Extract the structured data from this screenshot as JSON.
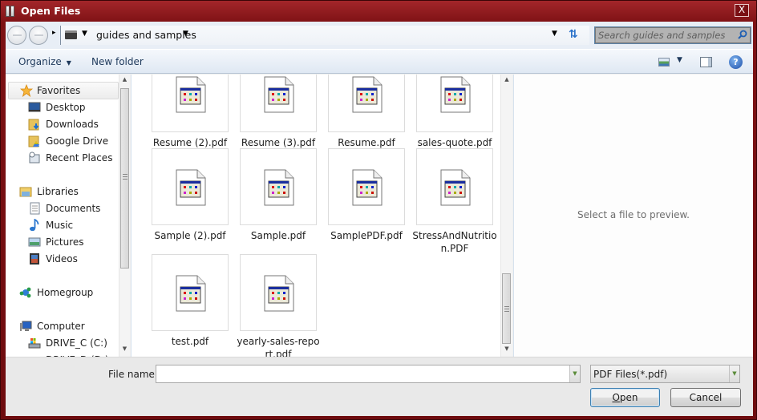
{
  "window": {
    "title": "Open Files",
    "close_label": "X"
  },
  "navbar": {
    "breadcrumb": "guides and samples",
    "search_placeholder": "Search guides and samples"
  },
  "toolbar": {
    "organize_label": "Organize",
    "new_folder_label": "New folder",
    "help_label": "?"
  },
  "sidebar": {
    "favorites": {
      "label": "Favorites",
      "items": [
        {
          "label": "Desktop",
          "icon": "desktop-icon"
        },
        {
          "label": "Downloads",
          "icon": "downloads-folder-icon"
        },
        {
          "label": "Google Drive",
          "icon": "google-drive-folder-icon"
        },
        {
          "label": "Recent Places",
          "icon": "recent-places-icon"
        }
      ]
    },
    "libraries": {
      "label": "Libraries",
      "items": [
        {
          "label": "Documents",
          "icon": "documents-icon"
        },
        {
          "label": "Music",
          "icon": "music-icon"
        },
        {
          "label": "Pictures",
          "icon": "pictures-icon"
        },
        {
          "label": "Videos",
          "icon": "videos-icon"
        }
      ]
    },
    "homegroup": {
      "label": "Homegroup"
    },
    "computer": {
      "label": "Computer",
      "items": [
        {
          "label": "DRIVE_C (C:)",
          "icon": "drive-icon"
        },
        {
          "label": "DRIVE_D (D:)",
          "icon": "drive-icon"
        }
      ]
    }
  },
  "files": [
    {
      "name": "Resume (2).pdf"
    },
    {
      "name": "Resume (3).pdf"
    },
    {
      "name": "Resume.pdf"
    },
    {
      "name": "sales-quote.pdf"
    },
    {
      "name": "Sample (2).pdf"
    },
    {
      "name": "Sample.pdf"
    },
    {
      "name": "SamplePDF.pdf"
    },
    {
      "name": "StressAndNutrition.PDF"
    },
    {
      "name": "test.pdf"
    },
    {
      "name": "yearly-sales-report.pdf"
    }
  ],
  "preview": {
    "message": "Select a file to preview."
  },
  "bottom": {
    "file_name_label": "File name:",
    "file_name_value": "",
    "filter_value": "PDF Files(*.pdf)",
    "open_label": "Open",
    "cancel_label": "Cancel"
  }
}
